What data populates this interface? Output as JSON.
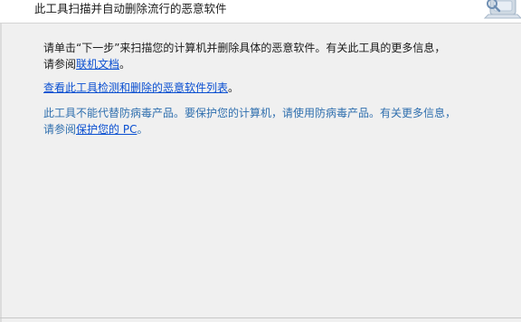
{
  "header": {
    "title": "此工具扫描并自动删除流行的恶意软件",
    "icon": "computer-scan-icon"
  },
  "body": {
    "p1_line1": "请单击“下一步”来扫描您的计算机并删除具体的恶意软件。有关此工具的更多信息，",
    "p1_line2_prefix": "请参阅",
    "p1_link": "联机文档",
    "p1_suffix": "。",
    "p2_link": "查看此工具检测和删除的恶意软件列表",
    "p2_suffix": "。",
    "p3_line1": "此工具不能代替防病毒产品。要保护您的计算机，请使用防病毒产品。有关更多信息，",
    "p3_line2_prefix": "请参阅",
    "p3_link": "保护您的 PC",
    "p3_suffix": "。"
  },
  "colors": {
    "link": "#0a4fd1",
    "muted_text": "#2f6fae",
    "background": "#f0f0f0",
    "header_background": "#ffffff"
  }
}
